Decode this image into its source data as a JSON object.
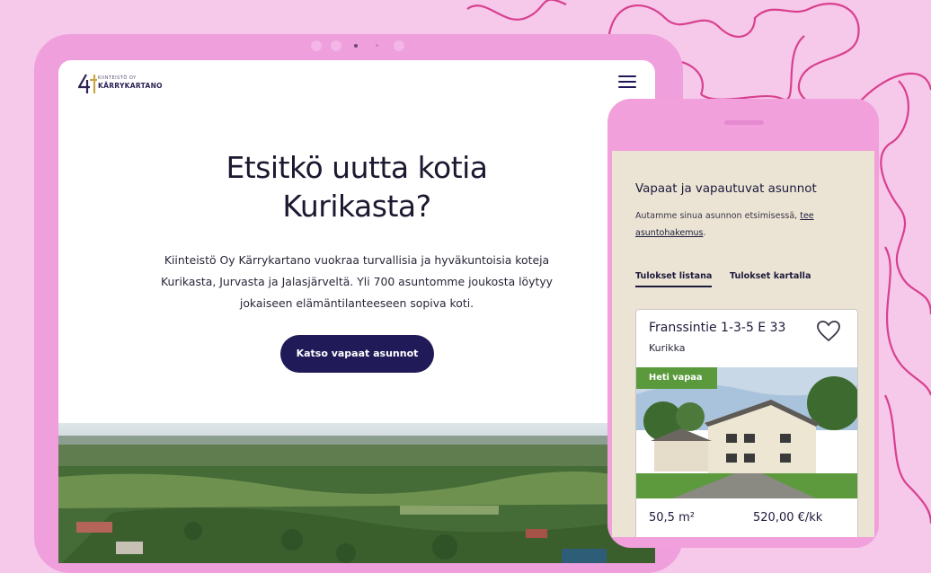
{
  "tablet": {
    "logo": {
      "small_text": "KIINTEISTÖ OY",
      "name": "KÄRRYKARTANO"
    },
    "hero": {
      "title_line1": "Etsitkö uutta kotia",
      "title_line2": "Kurikasta?",
      "text_line1": "Kiinteistö Oy Kärrykartano vuokraa turvallisia ja hyväkuntoisia koteja",
      "text_line2": "Kurikasta, Jurvasta ja Jalasjärveltä. Yli 700 asuntomme joukosta löytyy",
      "text_line3": "jokaiseen elämäntilanteeseen sopiva koti.",
      "cta_label": "Katso vapaat asunnot"
    }
  },
  "phone": {
    "title": "Vapaat ja vapautuvat asunnot",
    "intro_text": "Autamme sinua asunnon etsimisessä,",
    "intro_link_1": "tee",
    "intro_link_2": "asuntohakemus",
    "intro_end": ".",
    "tabs": [
      {
        "label": "Tulokset listana",
        "active": true
      },
      {
        "label": "Tulokset kartalla",
        "active": false
      }
    ],
    "listing": {
      "title": "Franssintie 1-3-5 E 33",
      "city": "Kurikka",
      "badge": "Heti vapaa",
      "size": "50,5 m²",
      "price": "520,00 €/kk"
    }
  },
  "colors": {
    "background": "#f6c8ea",
    "device_frame": "#ee9fdc",
    "cta_button": "#201a58",
    "badge": "#5a9a3c",
    "phone_screen": "#ebe4d5"
  },
  "icons": {
    "menu": "hamburger-menu-icon",
    "favorite": "heart-outline-icon"
  }
}
